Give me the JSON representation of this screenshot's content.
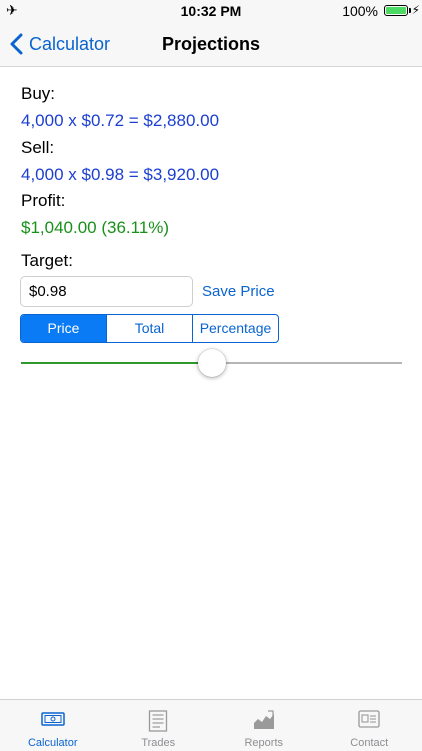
{
  "status_bar": {
    "time": "10:32 PM",
    "battery": "100%"
  },
  "nav": {
    "back_label": "Calculator",
    "title": "Projections"
  },
  "buy": {
    "label": "Buy:",
    "value": "4,000 x $0.72 = $2,880.00"
  },
  "sell": {
    "label": "Sell:",
    "value": "4,000 x $0.98 = $3,920.00"
  },
  "profit": {
    "label": "Profit:",
    "value": "$1,040.00 (36.11%)"
  },
  "target": {
    "label": "Target:",
    "input_value": "$0.98",
    "save_label": "Save Price"
  },
  "segments": {
    "items": [
      "Price",
      "Total",
      "Percentage"
    ],
    "selected": "Price"
  },
  "slider": {
    "level_fraction": 0.5
  },
  "tabs": [
    {
      "label": "Calculator",
      "icon": "calculator-icon",
      "active": true
    },
    {
      "label": "Trades",
      "icon": "trades-icon",
      "active": false
    },
    {
      "label": "Reports",
      "icon": "reports-icon",
      "active": false
    },
    {
      "label": "Contact",
      "icon": "contact-icon",
      "active": false
    }
  ],
  "colors": {
    "accent": "#0a64d0",
    "value_blue": "#1c3fd1",
    "profit_green": "#199119",
    "slider_min": "#2e9a2e"
  }
}
